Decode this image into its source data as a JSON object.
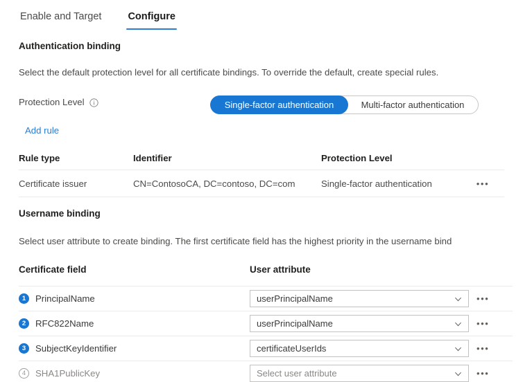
{
  "tabs": [
    {
      "label": "Enable and Target",
      "active": false
    },
    {
      "label": "Configure",
      "active": true
    }
  ],
  "authentication_binding": {
    "title": "Authentication binding",
    "description": "Select the default protection level for all certificate bindings. To override the default, create special rules.",
    "protection_level_label": "Protection Level",
    "info_icon": "info-icon",
    "segmented_control": {
      "options": [
        "Single-factor authentication",
        "Multi-factor authentication"
      ],
      "selected": "Single-factor authentication"
    },
    "add_rule_label": "Add rule",
    "table": {
      "columns": [
        "Rule type",
        "Identifier",
        "Protection Level"
      ],
      "rows": [
        {
          "rule_type": "Certificate issuer",
          "identifier": "CN=ContosoCA, DC=contoso, DC=com",
          "protection_level": "Single-factor authentication",
          "more_label": "•••"
        }
      ]
    }
  },
  "username_binding": {
    "title": "Username binding",
    "description": "Select user attribute to create binding. The first certificate field has the highest priority in the username bind",
    "columns": [
      "Certificate field",
      "User attribute"
    ],
    "rows": [
      {
        "index": "1",
        "certificate_field": "PrincipalName",
        "user_attribute": "userPrincipalName",
        "placeholder": "Select user attribute",
        "enabled": true,
        "more_label": "•••"
      },
      {
        "index": "2",
        "certificate_field": "RFC822Name",
        "user_attribute": "userPrincipalName",
        "placeholder": "Select user attribute",
        "enabled": true,
        "more_label": "•••"
      },
      {
        "index": "3",
        "certificate_field": "SubjectKeyIdentifier",
        "user_attribute": "certificateUserIds",
        "placeholder": "Select user attribute",
        "enabled": true,
        "more_label": "•••"
      },
      {
        "index": "4",
        "certificate_field": "SHA1PublicKey",
        "user_attribute": "",
        "placeholder": "Select user attribute",
        "enabled": false,
        "more_label": "•••"
      }
    ]
  },
  "colors": {
    "accent": "#1877d2",
    "link": "#2b7cd3",
    "text": "#3b3a39",
    "heading": "#201f1e",
    "muted": "#8a8886",
    "border": "#c8c6c4",
    "divider": "#edebe9"
  }
}
